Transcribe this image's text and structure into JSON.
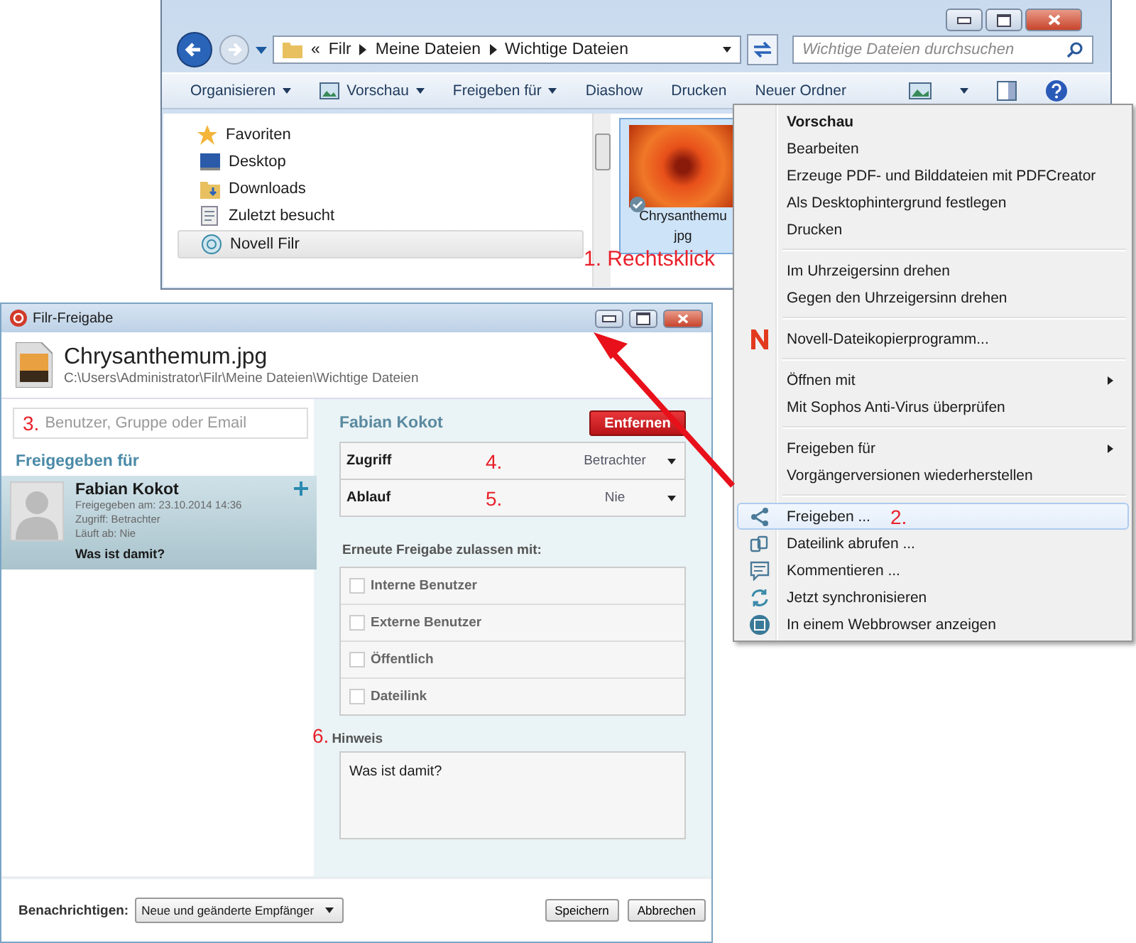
{
  "explorer": {
    "breadcrumb": [
      "«",
      "Filr",
      "Meine Dateien",
      "Wichtige Dateien"
    ],
    "search": {
      "placeholder": "Wichtige Dateien durchsuchen"
    },
    "toolbar": [
      {
        "label": "Organisieren",
        "dropdown": true
      },
      {
        "label": "Vorschau",
        "dropdown": true
      },
      {
        "label": "Freigeben für",
        "dropdown": true
      },
      {
        "label": "Diashow",
        "dropdown": false
      },
      {
        "label": "Drucken",
        "dropdown": false
      },
      {
        "label": "Neuer Ordner",
        "dropdown": false
      }
    ],
    "nav": [
      {
        "label": "Favoriten",
        "kind": "star",
        "selected": false
      },
      {
        "label": "Desktop",
        "kind": "desktop",
        "selected": false
      },
      {
        "label": "Downloads",
        "kind": "downloads",
        "selected": false
      },
      {
        "label": "Zuletzt besucht",
        "kind": "recent",
        "selected": false
      },
      {
        "label": "Novell Filr",
        "kind": "filr",
        "selected": true
      }
    ],
    "view_tools": true,
    "file": {
      "name": "Chrysanthemu",
      "extension": "jpg",
      "selected": true
    },
    "annotation": "1. Rechtsklick"
  },
  "context_menu": {
    "groups": [
      [
        {
          "label": "Vorschau",
          "bold": true,
          "kind": "plain",
          "submenu": false,
          "selected": false
        },
        {
          "label": "Bearbeiten",
          "bold": false,
          "kind": "plain",
          "submenu": false,
          "selected": false
        },
        {
          "label": "Erzeuge PDF- und Bilddateien mit PDFCreator",
          "bold": false,
          "kind": "plain",
          "submenu": false,
          "selected": false
        },
        {
          "label": "Als Desktophintergrund festlegen",
          "bold": false,
          "kind": "plain",
          "submenu": false,
          "selected": false
        },
        {
          "label": "Drucken",
          "bold": false,
          "kind": "plain",
          "submenu": false,
          "selected": false
        }
      ],
      [
        {
          "label": "Im Uhrzeigersinn drehen",
          "bold": false,
          "kind": "plain",
          "submenu": false,
          "selected": false
        },
        {
          "label": "Gegen den Uhrzeigersinn drehen",
          "bold": false,
          "kind": "plain",
          "submenu": false,
          "selected": false
        }
      ],
      [
        {
          "label": "Novell-Dateikopierprogramm...",
          "bold": false,
          "kind": "novell",
          "submenu": false,
          "selected": false
        }
      ],
      [
        {
          "label": "Öffnen mit",
          "bold": false,
          "kind": "plain",
          "submenu": true,
          "selected": false
        },
        {
          "label": "Mit Sophos Anti-Virus überprüfen",
          "bold": false,
          "kind": "plain",
          "submenu": false,
          "selected": false
        }
      ],
      [
        {
          "label": "Freigeben für",
          "bold": false,
          "kind": "plain",
          "submenu": true,
          "selected": false
        },
        {
          "label": "Vorgängerversionen wiederherstellen",
          "bold": false,
          "kind": "plain",
          "submenu": false,
          "selected": false
        }
      ],
      [
        {
          "label": "Freigeben ...",
          "bold": false,
          "kind": "share",
          "submenu": false,
          "selected": true,
          "annotation": "2."
        },
        {
          "label": "Dateilink abrufen ...",
          "bold": false,
          "kind": "link",
          "submenu": false,
          "selected": false
        },
        {
          "label": "Kommentieren ...",
          "bold": false,
          "kind": "comment",
          "submenu": false,
          "selected": false
        },
        {
          "label": "Jetzt synchronisieren",
          "bold": false,
          "kind": "sync",
          "submenu": false,
          "selected": false
        },
        {
          "label": "In einem Webbrowser anzeigen",
          "bold": false,
          "kind": "browser",
          "submenu": false,
          "selected": false
        }
      ]
    ]
  },
  "dialog": {
    "title": "Filr-Freigabe",
    "file_name": "Chrysanthemum.jpg",
    "path": "C:\\Users\\Administrator\\Filr\\Meine Dateien\\Wichtige Dateien",
    "search": {
      "annotation": "3.",
      "placeholder": "Benutzer, Gruppe oder Email"
    },
    "shared_with_heading": "Freigegeben für",
    "shares": [
      {
        "name": "Fabian Kokot",
        "shared_on": "Freigegeben am: 23.10.2014 14:36",
        "access": "Zugriff: Betrachter",
        "expires": "Läuft ab: Nie",
        "note": "Was ist damit?",
        "selected": true
      }
    ],
    "detail": {
      "name": "Fabian Kokot",
      "remove_button": "Entfernen",
      "fields": [
        {
          "label": "Zugriff",
          "annotation": "4.",
          "value": "Betrachter"
        },
        {
          "label": "Ablauf",
          "annotation": "5.",
          "value": "Nie"
        }
      ],
      "reshare_heading": "Erneute Freigabe zulassen mit:",
      "reshare_options": [
        {
          "label": "Interne Benutzer",
          "checked": false
        },
        {
          "label": "Externe Benutzer",
          "checked": false
        },
        {
          "label": "Öffentlich",
          "checked": false
        },
        {
          "label": "Dateilink",
          "checked": false
        }
      ],
      "note": {
        "annotation": "6.",
        "label": "Hinweis",
        "value": "Was ist damit?"
      }
    },
    "footer": {
      "notify_label": "Benachrichtigen:",
      "notify_value": "Neue und geänderte Empfänger",
      "buttons": [
        "Speichern",
        "Abbrechen"
      ]
    }
  }
}
